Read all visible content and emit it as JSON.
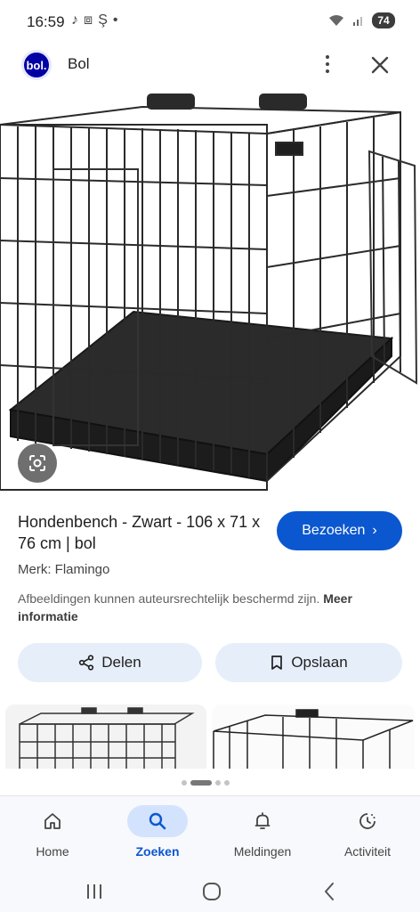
{
  "status_bar": {
    "time": "16:59",
    "battery": "74"
  },
  "header": {
    "logo_text": "bol.",
    "site_name": "Bol"
  },
  "result": {
    "title": "Hondenbench - Zwart - 106 x 71 x 76 cm | bol",
    "visit_label": "Bezoeken",
    "brand": "Merk: Flamingo",
    "notice_text": "Afbeeldingen kunnen auteursrechtelijk beschermd zijn.",
    "notice_link": "Meer informatie"
  },
  "actions": {
    "share_label": "Delen",
    "save_label": "Opslaan"
  },
  "bottom_nav": {
    "items": [
      {
        "label": "Home",
        "icon": "home-icon"
      },
      {
        "label": "Zoeken",
        "icon": "search-icon",
        "active": true
      },
      {
        "label": "Meldingen",
        "icon": "bell-icon"
      },
      {
        "label": "Activiteit",
        "icon": "activity-icon"
      }
    ]
  },
  "colors": {
    "accent": "#0b57d0",
    "chip_bg": "#e6eef9",
    "nav_active_bg": "#d3e3fd",
    "logo_bg": "#0000a4"
  }
}
